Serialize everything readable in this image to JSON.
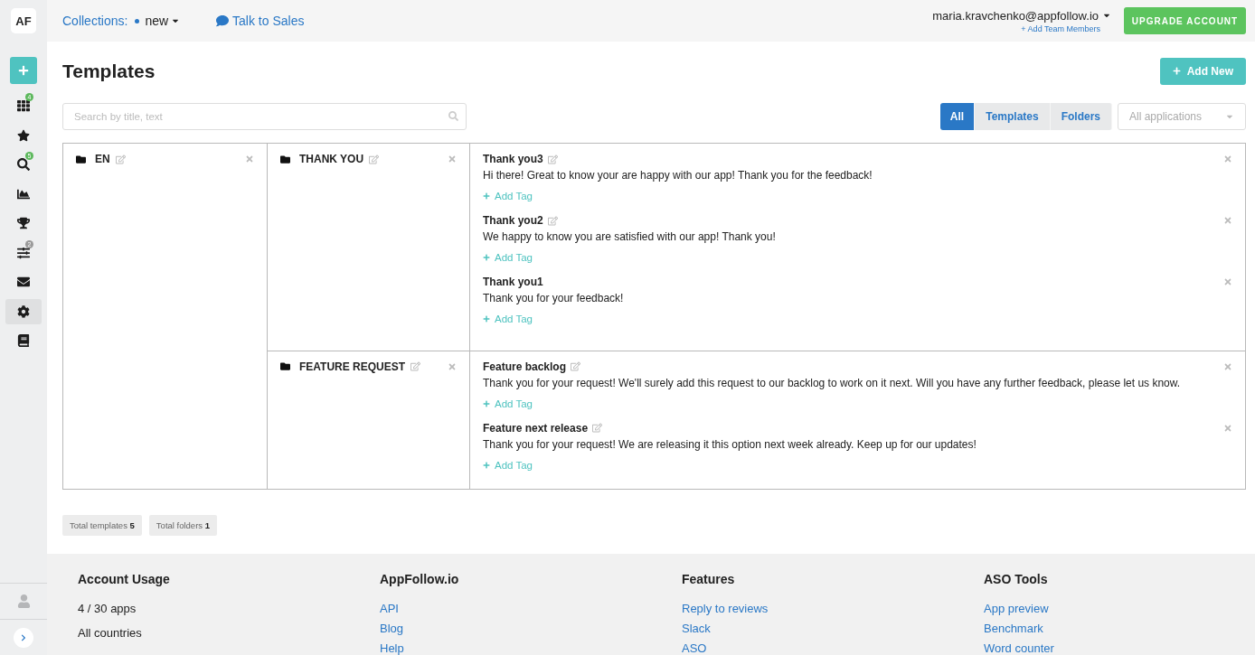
{
  "sidebar": {
    "logo": "AF",
    "items": [
      {
        "kind": "grid",
        "selected": false,
        "badge": {
          "text": "4",
          "color": "#5cb85c"
        }
      },
      {
        "kind": "star",
        "selected": false
      },
      {
        "kind": "search",
        "selected": false,
        "badge": {
          "text": "5",
          "color": "#5cb85c"
        }
      },
      {
        "kind": "chart",
        "selected": false
      },
      {
        "kind": "trophy",
        "selected": false
      },
      {
        "kind": "sliders",
        "selected": false,
        "badge": {
          "text": "2",
          "color": "#9a9a9a"
        }
      },
      {
        "kind": "mail",
        "selected": false
      },
      {
        "kind": "gear",
        "selected": true
      },
      {
        "kind": "book",
        "selected": false
      }
    ]
  },
  "header": {
    "collections_label": "Collections:",
    "collection": "new",
    "talk_to_sales": "Talk to Sales",
    "user_email": "maria.kravchenko@appfollow.io",
    "add_team_members": "+ Add Team Members",
    "upgrade_button": "UPGRADE ACCOUNT"
  },
  "page": {
    "title": "Templates",
    "add_new_button": "Add New",
    "search": {
      "placeholder": "Search by title, text"
    },
    "filter_tabs": [
      {
        "label": "All",
        "selected": true
      },
      {
        "label": "Templates",
        "selected": false
      },
      {
        "label": "Folders",
        "selected": false
      }
    ],
    "app_select": {
      "placeholder": "All applications"
    },
    "languages": [
      {
        "name": "EN",
        "folders": [
          {
            "name": "THANK YOU",
            "templates": [
              {
                "title": "Thank you3",
                "edit_icon": true,
                "text": "Hi there! Great to know your are happy with our app! Thank you for the feedback!",
                "add_tag": "Add Tag"
              },
              {
                "title": "Thank you2",
                "edit_icon": true,
                "text": "We happy to know you are satisfied with our app! Thank you!",
                "add_tag": "Add Tag"
              },
              {
                "title": "Thank you1",
                "edit_icon": false,
                "text": "Thank you for your feedback!",
                "add_tag": "Add Tag"
              }
            ]
          },
          {
            "name": "FEATURE REQUEST",
            "templates": [
              {
                "title": "Feature backlog",
                "edit_icon": true,
                "text": "Thank you for your request! We'll surely add this request to our backlog to work on it next. Will you have any further feedback, please let us know.",
                "add_tag": "Add Tag"
              },
              {
                "title": "Feature next release",
                "edit_icon": true,
                "text": "Thank you for your request! We are releasing it this option next week already. Keep up for our updates!",
                "add_tag": "Add Tag"
              }
            ]
          }
        ]
      }
    ],
    "totals": [
      {
        "label": "Total templates",
        "value": "5"
      },
      {
        "label": "Total folders",
        "value": "1"
      }
    ]
  },
  "footer": {
    "columns": [
      {
        "heading": "Account Usage",
        "kind": "text",
        "items": [
          "4 / 30 apps",
          "All countries"
        ]
      },
      {
        "heading": "AppFollow.io",
        "kind": "links",
        "items": [
          "API",
          "Blog",
          "Help"
        ]
      },
      {
        "heading": "Features",
        "kind": "links",
        "items": [
          "Reply to reviews",
          "Slack",
          "ASO"
        ]
      },
      {
        "heading": "ASO Tools",
        "kind": "links",
        "items": [
          "App preview",
          "Benchmark",
          "Word counter"
        ]
      }
    ]
  }
}
